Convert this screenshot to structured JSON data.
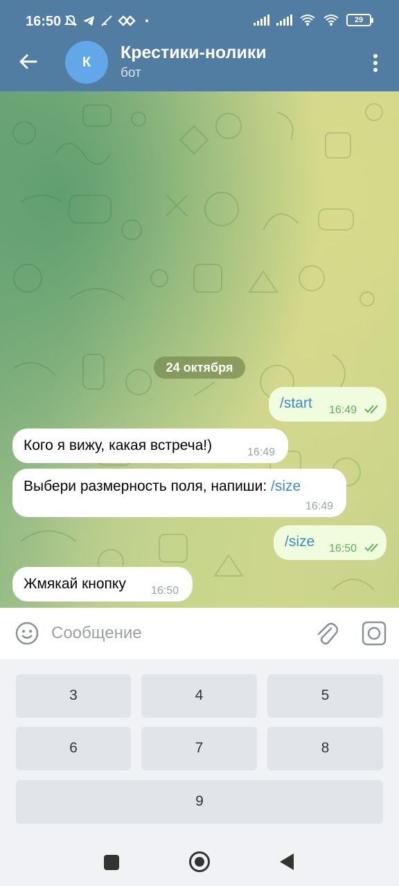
{
  "status_bar": {
    "time": "16:50",
    "battery": "29",
    "icons": [
      "mute-icon",
      "telegram-icon",
      "feather-icon",
      "vpn-icon",
      "dot-icon",
      "signal-icon",
      "signal-icon",
      "wifi-icon",
      "wifi-icon",
      "battery-icon"
    ]
  },
  "header": {
    "avatar_letter": "К",
    "title": "Крестики-нолики",
    "subtitle": "бот",
    "back_icon": "arrow-left-icon",
    "menu_icon": "more-vertical-icon"
  },
  "chat": {
    "date_chip": "24 октября",
    "messages": [
      {
        "direction": "out",
        "text": "/start",
        "time": "16:49",
        "read": true
      },
      {
        "direction": "in",
        "text": "Кого я вижу, какая встреча!)",
        "time": "16:49"
      },
      {
        "direction": "in",
        "text": "Выбери размерность поля, напиши: ",
        "command": "/size",
        "time": "16:49"
      },
      {
        "direction": "out",
        "text": "/size",
        "time": "16:50",
        "read": true
      },
      {
        "direction": "in",
        "text": "Жмякай кнопку",
        "time": "16:50"
      }
    ]
  },
  "input": {
    "placeholder": "Сообщение",
    "value": ""
  },
  "keyboard": {
    "keys": [
      "3",
      "4",
      "5",
      "6",
      "7",
      "8",
      "9"
    ]
  },
  "colors": {
    "header": "#517da2",
    "outgoing_bubble": "#effdde",
    "incoming_bubble": "#ffffff",
    "link": "#3a8cc7",
    "read_check": "#5fb25c"
  }
}
